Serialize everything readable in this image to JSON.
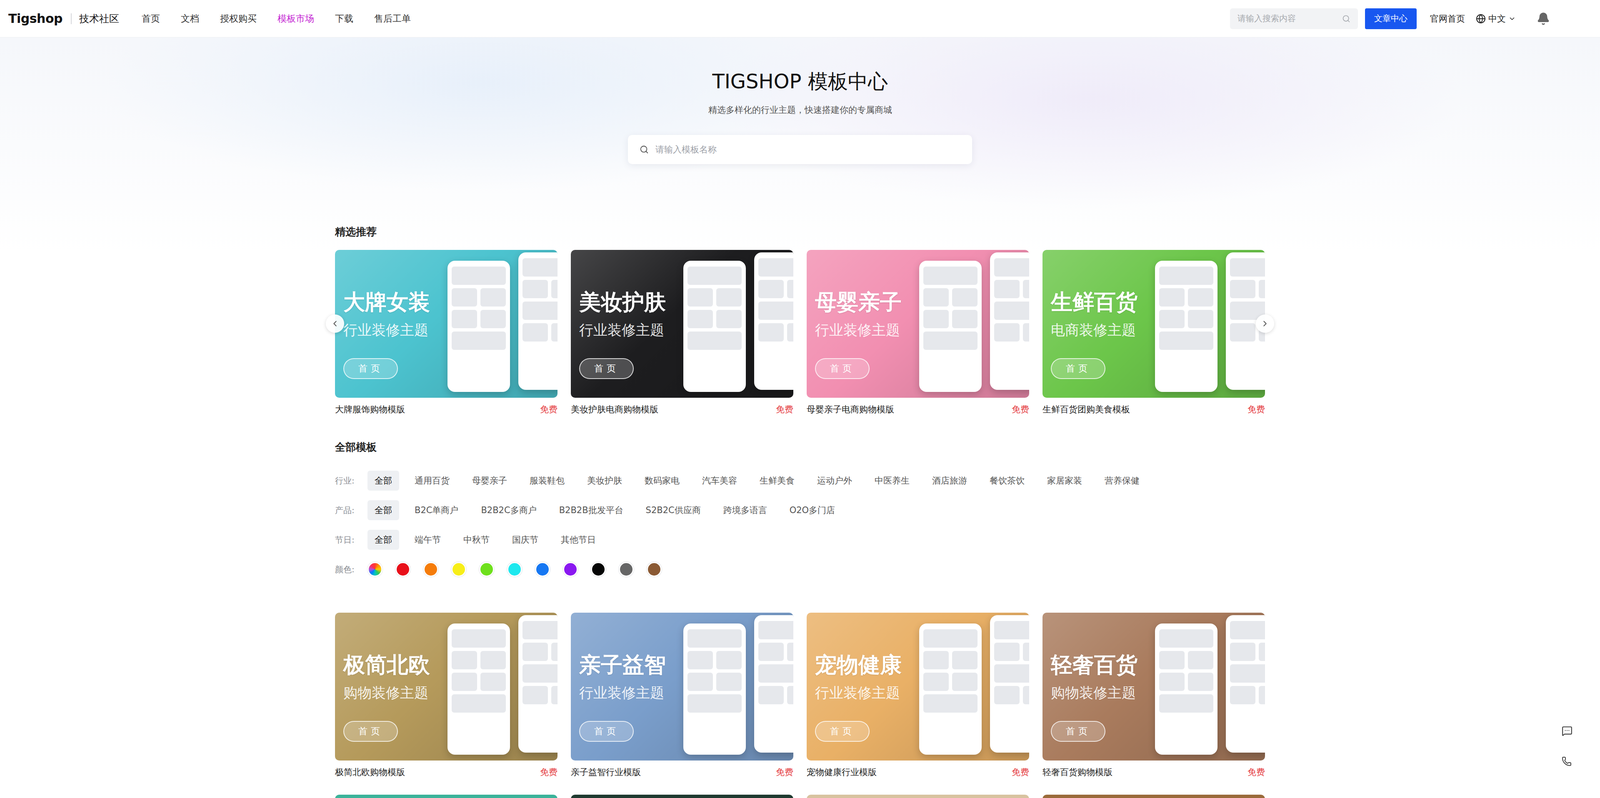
{
  "header": {
    "logo": "Tigshop",
    "community": "技术社区",
    "nav": [
      {
        "label": "首页",
        "selected": false
      },
      {
        "label": "文档",
        "selected": false
      },
      {
        "label": "授权购买",
        "selected": false
      },
      {
        "label": "模板市场",
        "selected": true
      },
      {
        "label": "下载",
        "selected": false
      },
      {
        "label": "售后工单",
        "selected": false
      }
    ],
    "search_placeholder": "请输入搜索内容",
    "primary_button": "文章中心",
    "link": "官网首页",
    "language": "中文"
  },
  "hero": {
    "title": "TIGSHOP 模板中心",
    "subtitle": "精选多样化的行业主题，快速搭建你的专属商城",
    "search_placeholder": "请输入模板名称"
  },
  "featured": {
    "title": "精选推荐",
    "cards": [
      {
        "headline": "大牌女装",
        "tagline": "行业装修主题",
        "button": "首页",
        "name": "大牌服饰购物模版",
        "price": "免费",
        "color": "#4cc3cf"
      },
      {
        "headline": "美妆护肤",
        "tagline": "行业装修主题",
        "button": "首页",
        "name": "美妆护肤电商购物模版",
        "price": "免费",
        "color": "#1d1d1f"
      },
      {
        "headline": "母婴亲子",
        "tagline": "行业装修主题",
        "button": "首页",
        "name": "母婴亲子电商购物模版",
        "price": "免费",
        "color": "#f28fb1"
      },
      {
        "headline": "生鲜百货",
        "tagline": "电商装修主题",
        "button": "首页",
        "name": "生鲜百货团购美食模板",
        "price": "免费",
        "color": "#6cc64a"
      }
    ]
  },
  "all": {
    "title": "全部模板",
    "filters": [
      {
        "label": "行业:",
        "kind": "text",
        "options": [
          {
            "label": "全部",
            "selected": true
          },
          {
            "label": "通用百货",
            "selected": false
          },
          {
            "label": "母婴亲子",
            "selected": false
          },
          {
            "label": "服装鞋包",
            "selected": false
          },
          {
            "label": "美妆护肤",
            "selected": false
          },
          {
            "label": "数码家电",
            "selected": false
          },
          {
            "label": "汽车美容",
            "selected": false
          },
          {
            "label": "生鲜美食",
            "selected": false
          },
          {
            "label": "运动户外",
            "selected": false
          },
          {
            "label": "中医养生",
            "selected": false
          },
          {
            "label": "酒店旅游",
            "selected": false
          },
          {
            "label": "餐饮茶饮",
            "selected": false
          },
          {
            "label": "家居家装",
            "selected": false
          },
          {
            "label": "营养保健",
            "selected": false
          }
        ]
      },
      {
        "label": "产品:",
        "kind": "text",
        "options": [
          {
            "label": "全部",
            "selected": true
          },
          {
            "label": "B2C单商户",
            "selected": false
          },
          {
            "label": "B2B2C多商户",
            "selected": false
          },
          {
            "label": "B2B2B批发平台",
            "selected": false
          },
          {
            "label": "S2B2C供应商",
            "selected": false
          },
          {
            "label": "跨境多语言",
            "selected": false
          },
          {
            "label": "O2O多门店",
            "selected": false
          }
        ]
      },
      {
        "label": "节日:",
        "kind": "text",
        "options": [
          {
            "label": "全部",
            "selected": true
          },
          {
            "label": "端午节",
            "selected": false
          },
          {
            "label": "中秋节",
            "selected": false
          },
          {
            "label": "国庆节",
            "selected": false
          },
          {
            "label": "其他节日",
            "selected": false
          }
        ]
      },
      {
        "label": "颜色:",
        "kind": "color",
        "options": [
          {
            "kind": "all",
            "color": "#ffffff",
            "selected": false
          },
          {
            "kind": "solid",
            "color": "#e8101a",
            "selected": false
          },
          {
            "kind": "solid",
            "color": "#f57c0b",
            "selected": false
          },
          {
            "kind": "solid",
            "color": "#f7ee19",
            "selected": false
          },
          {
            "kind": "solid",
            "color": "#6ee01c",
            "selected": false
          },
          {
            "kind": "solid",
            "color": "#1ee8ee",
            "selected": false
          },
          {
            "kind": "solid",
            "color": "#1677f2",
            "selected": false
          },
          {
            "kind": "solid",
            "color": "#8a18f0",
            "selected": false
          },
          {
            "kind": "solid",
            "color": "#050505",
            "selected": false
          },
          {
            "kind": "solid",
            "color": "#666666",
            "selected": false
          },
          {
            "kind": "solid",
            "color": "#8b5a34",
            "selected": false
          }
        ]
      }
    ],
    "cards": [
      {
        "headline": "极简北欧",
        "tagline": "购物装修主题",
        "button": "首页",
        "name": "极简北欧购物模版",
        "price": "免费",
        "color": "#b59a5b"
      },
      {
        "headline": "亲子益智",
        "tagline": "行业装修主题",
        "button": "首页",
        "name": "亲子益智行业模版",
        "price": "免费",
        "color": "#7a9ecb"
      },
      {
        "headline": "宠物健康",
        "tagline": "行业装修主题",
        "button": "首页",
        "name": "宠物健康行业模版",
        "price": "免费",
        "color": "#e9b066"
      },
      {
        "headline": "轻奢百货",
        "tagline": "购物装修主题",
        "button": "首页",
        "name": "轻奢百货购物模版",
        "price": "免费",
        "color": "#a97b5d"
      }
    ],
    "more_cards": [
      {
        "color": "#3bb39a"
      },
      {
        "color": "#1f3a30"
      },
      {
        "color": "#d8c3a0"
      },
      {
        "color": "#9a6b3a"
      }
    ]
  }
}
